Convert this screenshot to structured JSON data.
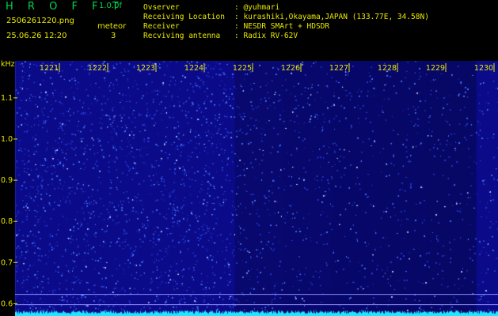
{
  "header": {
    "app_name": "H R O F F T",
    "version": "1.0.0f",
    "filename": "2506261220.png",
    "datetime": "25.06.26 12:20",
    "meteor_label": "meteor",
    "meteor_count": "3",
    "info": [
      {
        "label": "Ovserver",
        "value": ": @yuhmari"
      },
      {
        "label": "Receiving Location",
        "value": ": kurashiki,Okayama,JAPAN (133.77E, 34.58N)"
      },
      {
        "label": "Receiver",
        "value": ": NESDR SMArt + HDSDR"
      },
      {
        "label": "Recviving antenna",
        "value": ": Radix RV-62V"
      }
    ]
  },
  "colors": {
    "background": "#000000",
    "header_text": "#e8e800",
    "brand_text": "#00d64a",
    "spectrogram_base": "#0b0b8a",
    "noise_dot": "#4a7cff",
    "power_trace": "#22e6ff",
    "hline": "#8a8aff"
  },
  "chart_data": {
    "type": "heatmap",
    "ylabel": "kHz",
    "y_ticks": [
      "1.1",
      "1.0",
      "0.9",
      "0.8",
      "0.7",
      "0.6"
    ],
    "y_values": [
      1.1,
      1.0,
      0.9,
      0.8,
      0.7,
      0.6
    ],
    "x_ticks": [
      "1221",
      "1222",
      "1223",
      "1224",
      "1225",
      "1226",
      "1227",
      "1228",
      "1229",
      "1230"
    ],
    "ylim": [
      0.57,
      1.19
    ],
    "reference_lines_khz": [
      0.6225,
      0.5975
    ],
    "noise_levels_by_minute": [
      1.0,
      1.0,
      1.0,
      1.0,
      1.0,
      0.55,
      0.5,
      0.45,
      0.42,
      0.4
    ],
    "meteor_count": 3
  }
}
